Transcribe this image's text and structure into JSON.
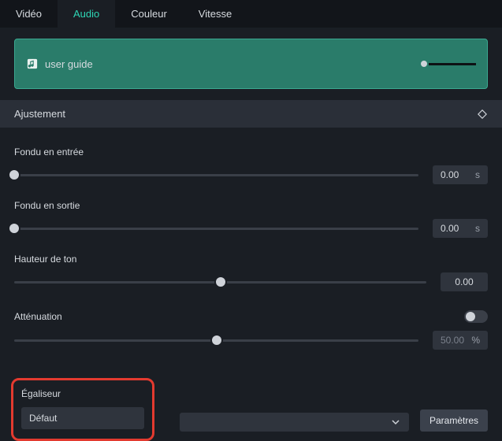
{
  "tabs": {
    "video": "Vidéo",
    "audio": "Audio",
    "color": "Couleur",
    "speed": "Vitesse"
  },
  "clip": {
    "name": "user guide"
  },
  "section": {
    "adjustment": "Ajustement"
  },
  "controls": {
    "fade_in": {
      "label": "Fondu en entrée",
      "value": "0.00",
      "unit": "s",
      "thumb_pct": 0
    },
    "fade_out": {
      "label": "Fondu en sortie",
      "value": "0.00",
      "unit": "s",
      "thumb_pct": 0
    },
    "pitch": {
      "label": "Hauteur de ton",
      "value": "0.00",
      "thumb_pct": 50
    },
    "attenuation": {
      "label": "Atténuation",
      "value": "50.00",
      "unit": "%",
      "thumb_pct": 50,
      "enabled": false
    }
  },
  "equalizer": {
    "label": "Égaliseur",
    "selected": "Défaut",
    "button": "Paramètres"
  }
}
